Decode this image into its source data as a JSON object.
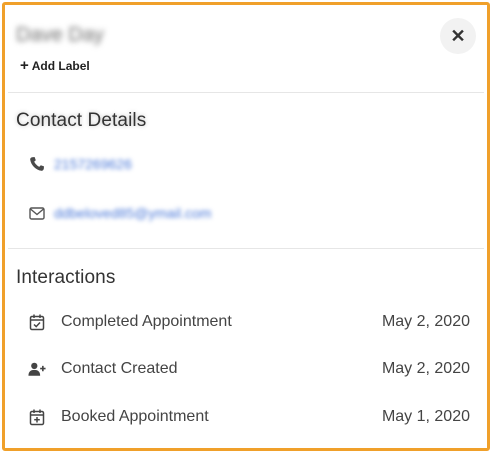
{
  "header": {
    "contact_name": "Dave Day",
    "add_label": "Add Label",
    "close_icon": "close-icon"
  },
  "contact_details": {
    "title": "Contact Details",
    "phone": "2157269626",
    "email": "ddbeloved85@ymail.com"
  },
  "interactions": {
    "title": "Interactions",
    "items": [
      {
        "label": "Completed Appointment",
        "date": "May 2, 2020",
        "icon": "calendar-check-icon"
      },
      {
        "label": "Contact Created",
        "date": "May 2, 2020",
        "icon": "user-plus-icon"
      },
      {
        "label": "Booked Appointment",
        "date": "May 1, 2020",
        "icon": "calendar-plus-icon"
      }
    ]
  },
  "colors": {
    "frame_border": "#f0a02a",
    "link": "#4a78d8"
  }
}
